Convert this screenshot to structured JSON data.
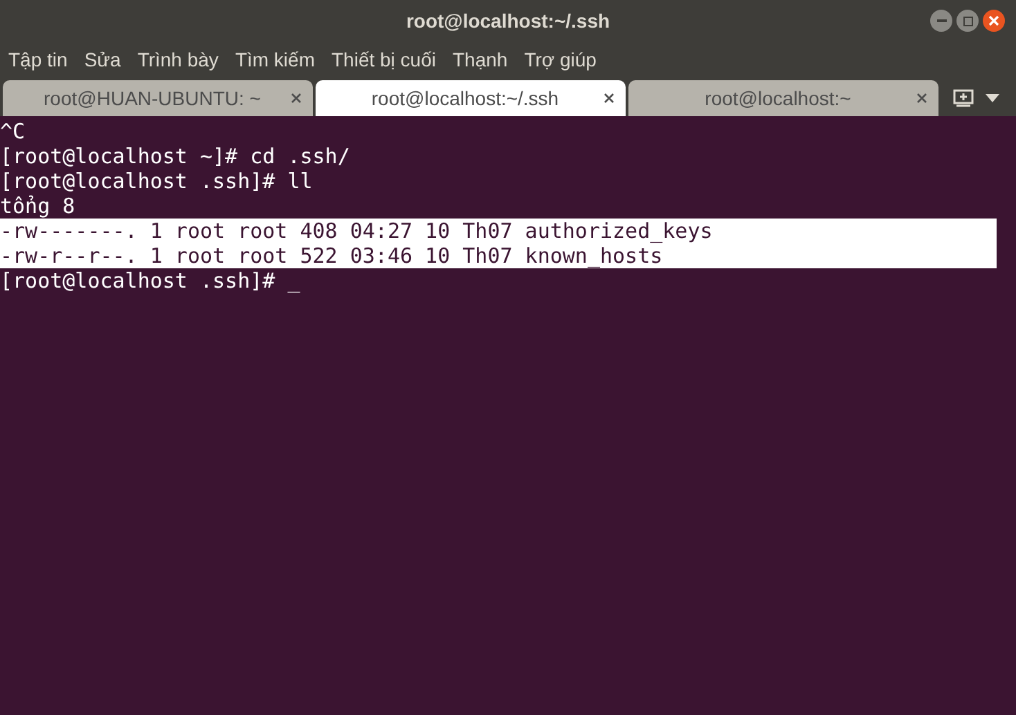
{
  "window": {
    "title": "root@localhost:~/.ssh"
  },
  "menu": [
    "Tập tin",
    "Sửa",
    "Trình bày",
    "Tìm kiếm",
    "Thiết bị cuối",
    "Thạnh",
    "Trợ giúp"
  ],
  "tabs": [
    {
      "label": "root@HUAN-UBUNTU: ~",
      "selected": false
    },
    {
      "label": "root@localhost:~/.ssh",
      "selected": true
    },
    {
      "label": "root@localhost:~",
      "selected": false
    }
  ],
  "terminal": {
    "lines": [
      {
        "text": "^C",
        "selected": false
      },
      {
        "text": "[root@localhost ~]# cd .ssh/",
        "selected": false
      },
      {
        "text": "[root@localhost .ssh]# ll",
        "selected": false
      },
      {
        "text": "tổng 8",
        "selected": false
      },
      {
        "text": "-rw-------. 1 root root 408 04:27 10 Th07 authorized_keys",
        "selected": true
      },
      {
        "text": "-rw-r--r--. 1 root root 522 03:46 10 Th07 known_hosts",
        "selected": true
      },
      {
        "text": "[root@localhost .ssh]# _",
        "selected": false
      }
    ]
  }
}
